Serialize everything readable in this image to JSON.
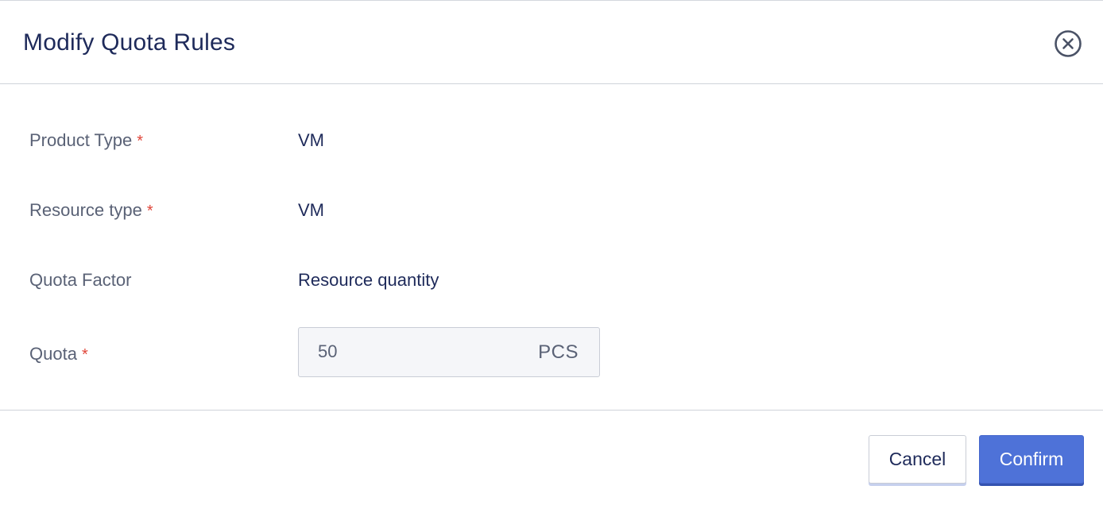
{
  "dialog": {
    "title": "Modify Quota Rules",
    "close_icon": "close-circle-icon"
  },
  "form": {
    "product_type": {
      "label": "Product Type",
      "required": "*",
      "value": "VM"
    },
    "resource_type": {
      "label": "Resource type",
      "required": "*",
      "value": "VM"
    },
    "quota_factor": {
      "label": "Quota Factor",
      "value": "Resource quantity"
    },
    "quota": {
      "label": "Quota",
      "required": "*",
      "value": "50",
      "unit": "PCS"
    }
  },
  "footer": {
    "cancel_label": "Cancel",
    "confirm_label": "Confirm"
  },
  "colors": {
    "title": "#1e2a5a",
    "label": "#5a6276",
    "required": "#e0463a",
    "primary": "#4e72d8",
    "border": "#c9cdd6"
  }
}
